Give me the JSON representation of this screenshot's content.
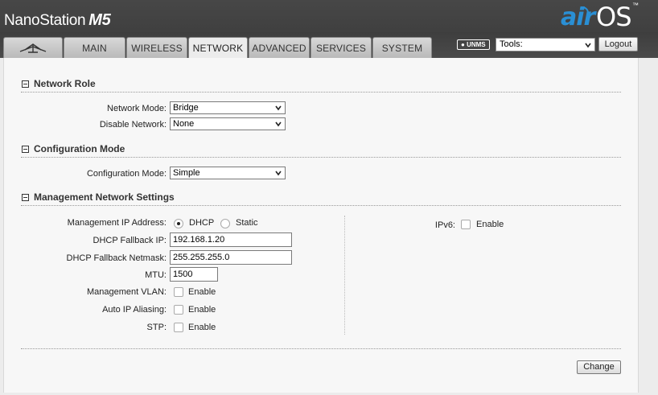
{
  "header": {
    "product_name": "NanoStation",
    "product_model": "M5",
    "logo_air": "air",
    "logo_os": "OS",
    "logo_tm": "™"
  },
  "tabs": [
    {
      "label": "",
      "icon": "ubiquiti-antenna-icon"
    },
    {
      "label": "MAIN"
    },
    {
      "label": "WIRELESS"
    },
    {
      "label": "NETWORK",
      "active": true
    },
    {
      "label": "ADVANCED"
    },
    {
      "label": "SERVICES"
    },
    {
      "label": "SYSTEM"
    }
  ],
  "toolbar": {
    "unms_label": "UNMS",
    "tools_value": "Tools:",
    "logout_label": "Logout"
  },
  "network_role": {
    "title": "Network Role",
    "network_mode_label": "Network Mode:",
    "network_mode_value": "Bridge",
    "disable_network_label": "Disable Network:",
    "disable_network_value": "None"
  },
  "configuration_mode": {
    "title": "Configuration Mode",
    "label": "Configuration Mode:",
    "value": "Simple"
  },
  "management": {
    "title": "Management Network Settings",
    "ip_address_label": "Management IP Address:",
    "dhcp_label": "DHCP",
    "static_label": "Static",
    "fallback_ip_label": "DHCP Fallback IP:",
    "fallback_ip_value": "192.168.1.20",
    "fallback_netmask_label": "DHCP Fallback Netmask:",
    "fallback_netmask_value": "255.255.255.0",
    "mtu_label": "MTU:",
    "mtu_value": "1500",
    "vlan_label": "Management VLAN:",
    "auto_ip_label": "Auto IP Aliasing:",
    "stp_label": "STP:",
    "enable_label": "Enable",
    "ipv6_label": "IPv6:"
  },
  "actions": {
    "change_label": "Change"
  },
  "colors": {
    "header_bg": "#3f3f3f",
    "logo_blue": "#2a8fd4",
    "panel_bg": "#f7f7f7"
  }
}
